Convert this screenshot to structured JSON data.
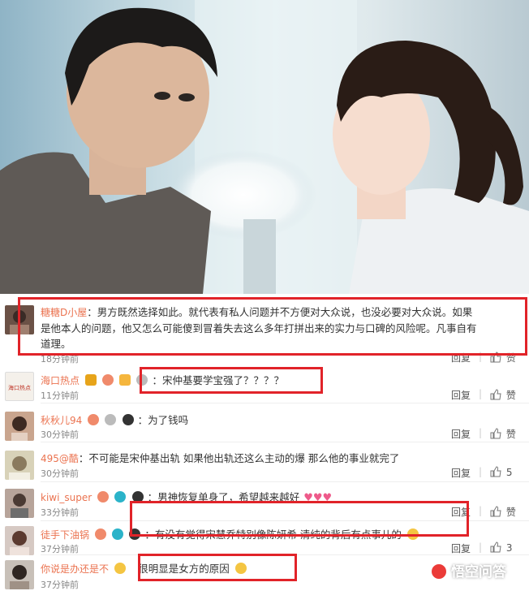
{
  "comments": [
    {
      "user": "糖糖D小屋",
      "text_lines": [
        "：男方既然选择如此。就代表有私人问题并不方便对大众说，也没必要对大众说。如果",
        "是他本人的问题，他又怎么可能傻到冒着失去这么多年打拼出来的实力与口碑的风险呢。凡事自有",
        "道理。"
      ],
      "time": "18分钟前",
      "reply": "回复",
      "like": "赞"
    },
    {
      "user": "海口热点",
      "text": "：宋仲基要学宝强了？？？？",
      "time": "11分钟前",
      "reply": "回复",
      "like": "赞"
    },
    {
      "user": "秋秋儿94",
      "text": "：为了钱吗",
      "time": "30分钟前",
      "reply": "回复",
      "like": "赞"
    },
    {
      "user": "495@酷",
      "text": "：不可能是宋仲基出轨 如果他出轨还这么主动的爆 那么他的事业就完了",
      "time": "30分钟前",
      "reply": "回复",
      "like": "5"
    },
    {
      "user": "kiwi_super",
      "text": "：男神恢复单身了，希望越来越好",
      "time": "33分钟前",
      "reply": "回复",
      "like": "赞"
    },
    {
      "user": "徒手下油锅",
      "text": "：有没有觉得宋慧乔特别像陈妍希 清纯的背后有点事儿的",
      "time": "37分钟前",
      "reply": "回复",
      "like": "3"
    },
    {
      "user": "你说是办还是不",
      "text": "很明显是女方的原因",
      "time": "37分钟前"
    }
  ],
  "avatar_banner_text": "海口热点",
  "watermark": "悟空问答",
  "colors": {
    "username": "#eb7350",
    "highlight_box": "#e12329",
    "watermark_logo": "#eb3b38"
  }
}
